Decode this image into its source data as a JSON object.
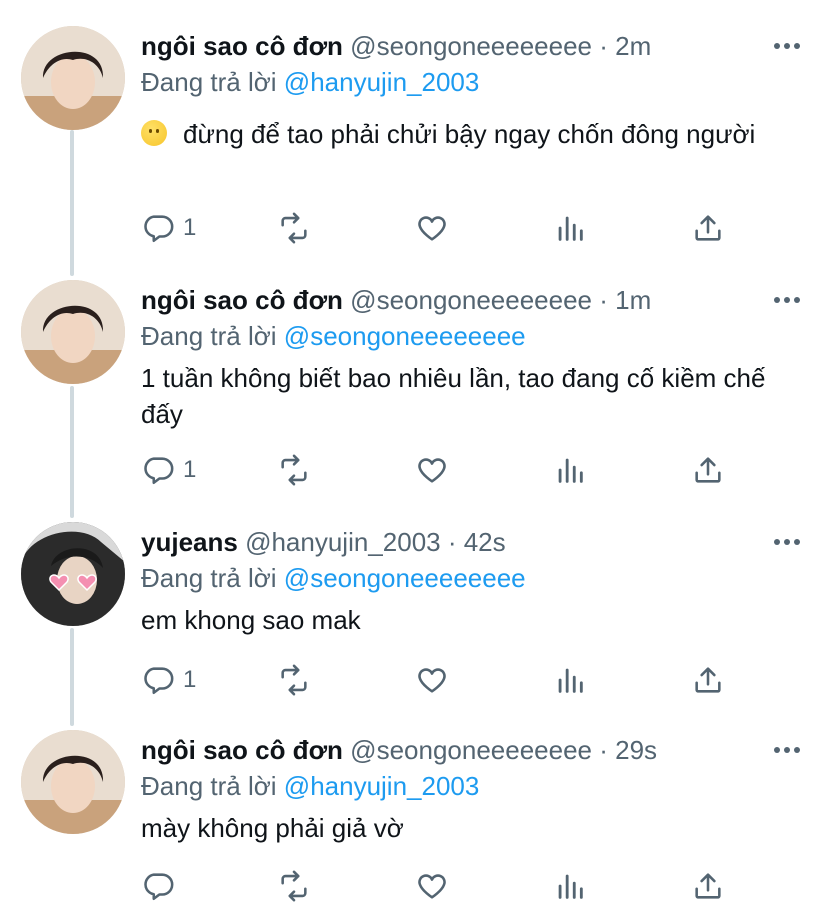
{
  "replying_to_prefix": "Đang trả lời",
  "tweets": [
    {
      "name": "ngôi sao cô đơn",
      "handle": "@seongoneeeeeeee",
      "time": "· 2m",
      "replying_to": "@hanyujin_2003",
      "text": "đừng để tao phải chửi bậy ngay chốn đông người",
      "reply_count": "1"
    },
    {
      "name": "ngôi sao cô đơn",
      "handle": "@seongoneeeeeeee",
      "time": "· 1m",
      "replying_to": "@seongoneeeeeeee",
      "text": "1 tuần không biết bao nhiêu lần, tao đang cố kiềm chế đấy",
      "reply_count": "1"
    },
    {
      "name": "yujeans",
      "handle": "@hanyujin_2003",
      "time": "· 42s",
      "replying_to": "@seongoneeeeeeee",
      "text": "em khong sao mak",
      "reply_count": "1"
    },
    {
      "name": "ngôi sao cô đơn",
      "handle": "@seongoneeeeeeee",
      "time": "· 29s",
      "replying_to": "@hanyujin_2003",
      "text": "mày không phải giả vờ",
      "reply_count": ""
    }
  ],
  "icons": {
    "reply": "reply-icon",
    "retweet": "retweet-icon",
    "like": "heart-icon",
    "views": "analytics-icon",
    "share": "share-icon",
    "more": "more-icon"
  },
  "colors": {
    "text": "#0f1419",
    "secondary": "#536471",
    "link": "#1d9bf0",
    "thread_line": "#cfd9de"
  }
}
